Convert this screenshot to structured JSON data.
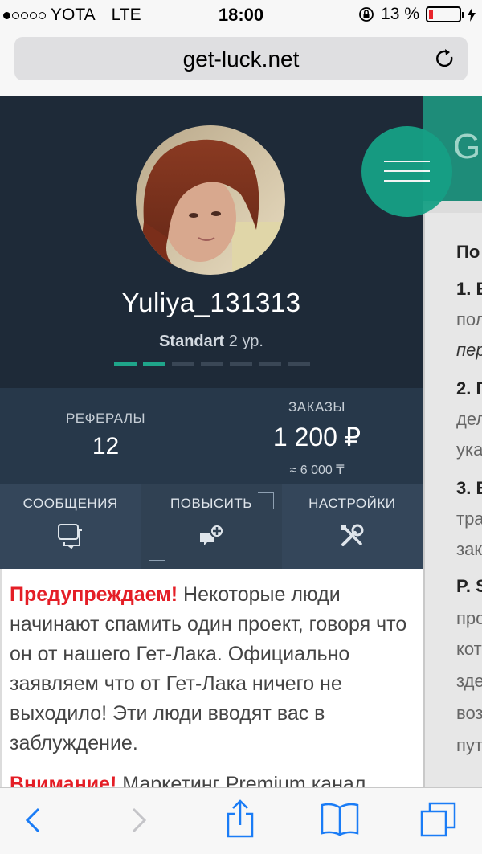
{
  "status_bar": {
    "carrier": "YOTA",
    "network": "LTE",
    "time": "18:00",
    "battery_percent": "13 %",
    "battery_level": 0.13
  },
  "browser": {
    "url": "get-luck.net"
  },
  "profile": {
    "username": "Yuliya_131313",
    "level_name": "Standart",
    "level_number": "2 ур.",
    "progress_segments": [
      true,
      true,
      false,
      false,
      false,
      false,
      false
    ]
  },
  "stats": {
    "referrals_label": "РЕФЕРАЛЫ",
    "referrals_value": "12",
    "orders_label": "ЗАКАЗЫ",
    "orders_value": "1 200 ₽",
    "orders_sub": "≈ 6 000 ₸"
  },
  "actions": {
    "messages": "СООБЩЕНИЯ",
    "upgrade": "ПОВЫСИТЬ",
    "settings": "НАСТРОЙКИ"
  },
  "notice": {
    "warn_label": "Предупреждаем!",
    "text": "Некоторые люди начинают спамить один проект, говоря что он от нашего Гет-Лака. Официально заявляем что от Гет-Лака ничего не выходило! Эти люди вводят вас в заблуждение.",
    "next_warn": "Внимание!",
    "next_text": "Маркетинг Premium канал"
  },
  "background_page": {
    "header_letter": "G",
    "lines": [
      "По",
      "1. В",
      "пол",
      "пер",
      "2. Г",
      "дел",
      "ука",
      "3. В",
      "тра",
      "зак",
      "P. S",
      "про",
      "кот",
      "зде",
      "воз",
      "пут"
    ]
  },
  "colors": {
    "accent": "#16a085",
    "panel": "#1e2a38",
    "warning": "#e41e26",
    "ios_blue": "#1a7cf6"
  },
  "icons": {
    "reload": "reload-icon",
    "messages": "chat-icon",
    "upgrade": "upgrade-icon",
    "settings": "tools-icon",
    "menu": "hamburger-icon",
    "back": "back-icon",
    "forward": "forward-icon",
    "share": "share-icon",
    "bookmarks": "book-icon",
    "tabs": "tabs-icon"
  }
}
